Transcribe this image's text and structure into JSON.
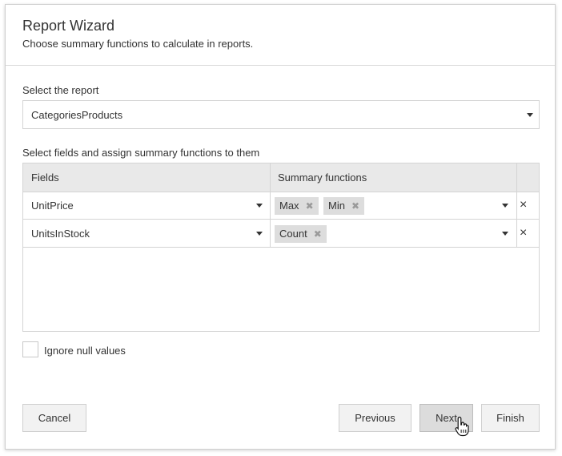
{
  "dialog": {
    "title": "Report Wizard",
    "subtitle": "Choose summary functions to calculate in reports."
  },
  "report_select": {
    "label": "Select the report",
    "value": "CategoriesProducts"
  },
  "fields_section": {
    "label": "Select fields and assign summary functions to them",
    "columns": [
      "Fields",
      "Summary functions"
    ],
    "rows": [
      {
        "field": "UnitPrice",
        "functions": [
          "Max",
          "Min"
        ]
      },
      {
        "field": "UnitsInStock",
        "functions": [
          "Count"
        ]
      }
    ]
  },
  "ignore_null": {
    "label": "Ignore null values",
    "checked": false
  },
  "buttons": {
    "cancel": "Cancel",
    "previous": "Previous",
    "next": "Next",
    "finish": "Finish"
  },
  "icons": {
    "remove_row": "×",
    "remove_tag": "✖"
  }
}
